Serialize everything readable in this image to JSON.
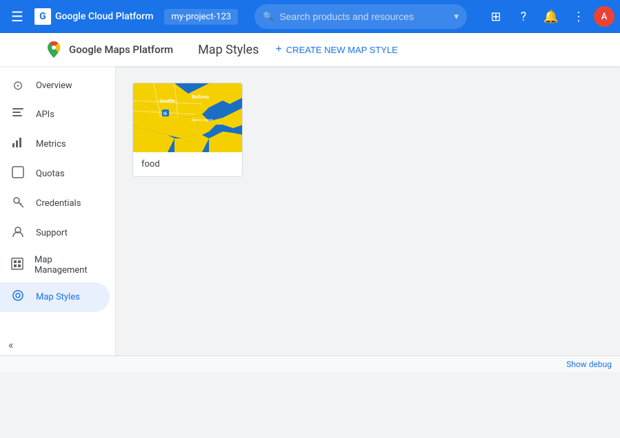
{
  "topbar": {
    "menu_icon": "☰",
    "app_title": "Google Cloud Platform",
    "project_name": "my-project-123",
    "search_placeholder": "Search products and resources",
    "icons": {
      "grid": "⊞",
      "help": "?",
      "bell": "🔔",
      "more": "⋮"
    },
    "avatar_initial": "A"
  },
  "subheader": {
    "title": "Google Maps Platform",
    "page_title": "Map Styles",
    "create_button": "CREATE NEW MAP STYLE"
  },
  "sidebar": {
    "items": [
      {
        "id": "overview",
        "label": "Overview",
        "icon": "⊙"
      },
      {
        "id": "apis",
        "label": "APIs",
        "icon": "☰"
      },
      {
        "id": "metrics",
        "label": "Metrics",
        "icon": "▦"
      },
      {
        "id": "quotas",
        "label": "Quotas",
        "icon": "⬜"
      },
      {
        "id": "credentials",
        "label": "Credentials",
        "icon": "🔑"
      },
      {
        "id": "support",
        "label": "Support",
        "icon": "👤"
      },
      {
        "id": "map-management",
        "label": "Map Management",
        "icon": "▣"
      },
      {
        "id": "map-styles",
        "label": "Map Styles",
        "icon": "◎",
        "active": true
      }
    ],
    "collapse_icon": "«"
  },
  "content": {
    "map_styles": [
      {
        "id": "food",
        "label": "food"
      }
    ]
  },
  "bottom_bar": {
    "debug_text": "Show debug"
  }
}
